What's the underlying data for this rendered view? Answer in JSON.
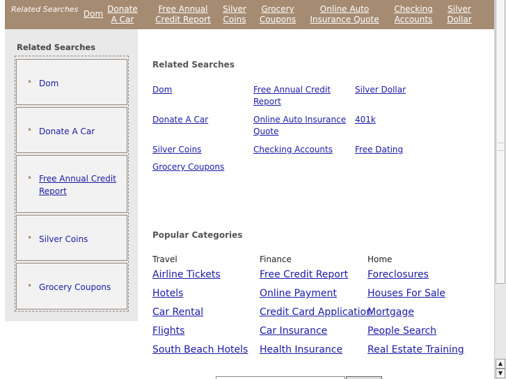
{
  "topbar": {
    "title": "Related Searches",
    "links": [
      {
        "label": "Dom"
      },
      {
        "label": "Donate A Car"
      },
      {
        "label": "Free Annual Credit Report"
      },
      {
        "label": "Silver Coins"
      },
      {
        "label": "Grocery Coupons"
      },
      {
        "label": "Online Auto Insurance Quote"
      },
      {
        "label": "Checking Accounts"
      },
      {
        "label": "Silver Dollar"
      }
    ],
    "background": "#a58b72"
  },
  "sidebar": {
    "title": "Related Searches",
    "items": [
      {
        "label": "Dom"
      },
      {
        "label": "Donate A Car"
      },
      {
        "label": "Free Annual Credit Report"
      },
      {
        "label": "Silver Coins"
      },
      {
        "label": "Grocery Coupons"
      }
    ]
  },
  "main": {
    "related_title": "Related Searches",
    "related_links": [
      "Dom",
      "Free Annual Credit Report",
      "Silver Dollar",
      "Donate A Car",
      "Online Auto Insurance Quote",
      "401k",
      "Silver Coins",
      "Checking Accounts",
      "Free Dating",
      "Grocery Coupons"
    ],
    "popular_title": "Popular Categories",
    "categories": [
      {
        "heading": "Travel",
        "links": [
          "Airline Tickets",
          "Hotels",
          "Car Rental",
          "Flights",
          "South Beach Hotels"
        ]
      },
      {
        "heading": "Finance",
        "links": [
          "Free Credit Report",
          "Online Payment",
          "Credit Card Application",
          "Car Insurance",
          "Health Insurance"
        ]
      },
      {
        "heading": "Home",
        "links": [
          "Foreclosures",
          "Houses For Sale",
          "Mortgage",
          "People Search",
          "Real Estate Training"
        ]
      }
    ]
  },
  "colors": {
    "link": "#1a1aa6",
    "sidebar_bg": "#e9e9e9",
    "bullet": "#a58b72"
  }
}
